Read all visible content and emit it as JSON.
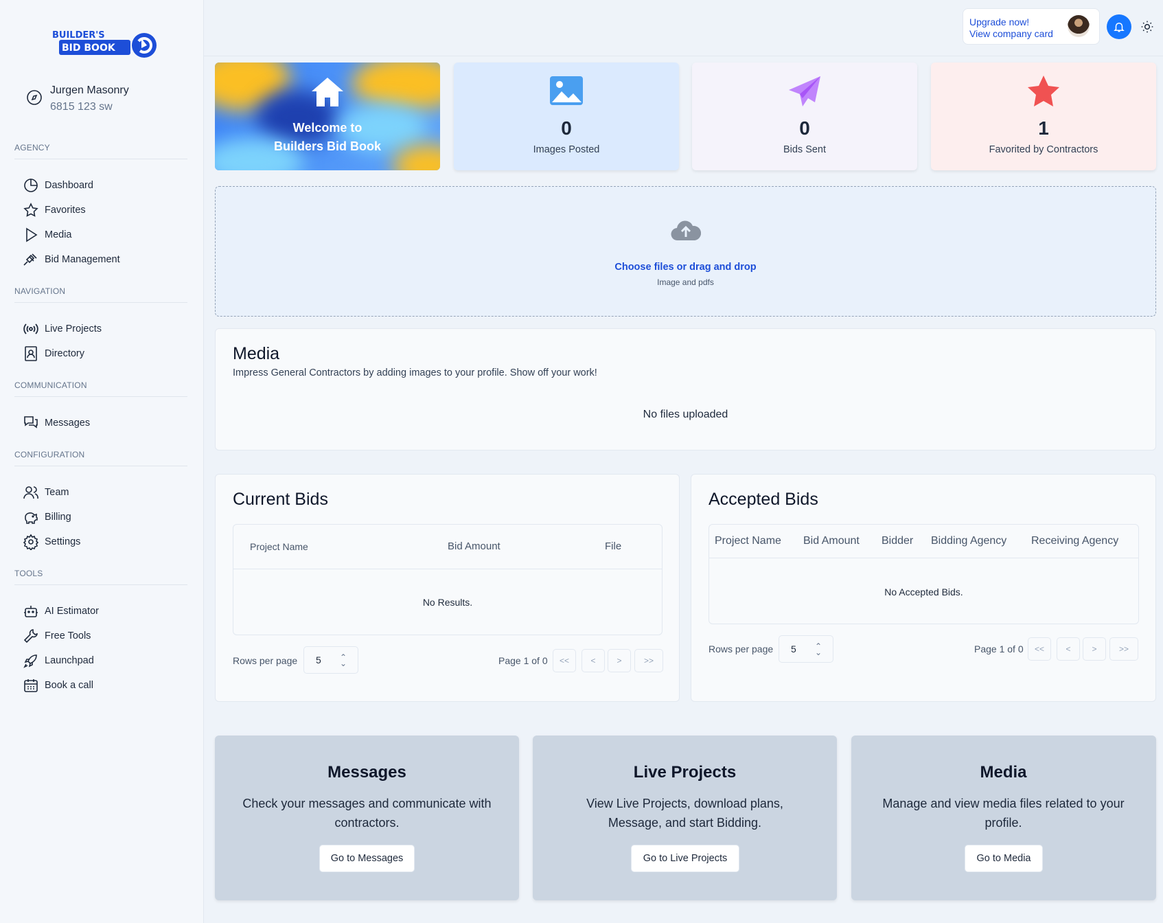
{
  "brand": {
    "line1": "BUILDER'S",
    "line2": "BID BOOK"
  },
  "company": {
    "name": "Jurgen Masonry",
    "address": "6815 123 sw"
  },
  "sidebar": {
    "sections": [
      {
        "title": "AGENCY"
      },
      {
        "title": "NAVIGATION"
      },
      {
        "title": "COMMUNICATION"
      },
      {
        "title": "CONFIGURATION"
      },
      {
        "title": "TOOLS"
      }
    ],
    "items": [
      {
        "label": "Dashboard"
      },
      {
        "label": "Favorites"
      },
      {
        "label": "Media"
      },
      {
        "label": "Bid Management"
      },
      {
        "label": "Live Projects"
      },
      {
        "label": "Directory"
      },
      {
        "label": "Messages"
      },
      {
        "label": "Team"
      },
      {
        "label": "Billing"
      },
      {
        "label": "Settings"
      },
      {
        "label": "AI Estimator"
      },
      {
        "label": "Free Tools"
      },
      {
        "label": "Launchpad"
      },
      {
        "label": "Book a call"
      }
    ]
  },
  "topbar": {
    "upgrade": "Upgrade now!",
    "company_card": "View company card"
  },
  "welcome": {
    "line1": "Welcome to",
    "line2": "Builders Bid Book"
  },
  "stats": [
    {
      "value": "0",
      "label": "Images Posted",
      "icon": "image-icon"
    },
    {
      "value": "0",
      "label": "Bids Sent",
      "icon": "paper-plane-icon"
    },
    {
      "value": "1",
      "label": "Favorited by Contractors",
      "icon": "star-icon"
    }
  ],
  "upload": {
    "choose": "Choose files or drag and drop",
    "hint": "Image and pdfs"
  },
  "media": {
    "title": "Media",
    "description": "Impress General Contractors by adding images to your profile. Show off your work!",
    "empty": "No files uploaded"
  },
  "current_bids": {
    "title": "Current Bids",
    "columns": [
      "Project Name",
      "Bid Amount",
      "File"
    ],
    "empty": "No Results.",
    "rows_per_page_label": "Rows per page",
    "rows_per_page": "5",
    "page_info": "Page 1 of 0"
  },
  "accepted_bids": {
    "title": "Accepted Bids",
    "columns": [
      "Project Name",
      "Bid Amount",
      "Bidder",
      "Bidding Agency",
      "Receiving Agency"
    ],
    "empty": "No Accepted Bids.",
    "rows_per_page_label": "Rows per page",
    "rows_per_page": "5",
    "page_info": "Page 1 of 0"
  },
  "pager": {
    "first": "<<",
    "prev": "<",
    "next": ">",
    "last": ">>"
  },
  "quick_cards": [
    {
      "title": "Messages",
      "description": "Check your messages and communicate with contractors.",
      "button": "Go to Messages"
    },
    {
      "title": "Live Projects",
      "description": "View Live Projects, download plans, Message, and start Bidding.",
      "button": "Go to Live Projects"
    },
    {
      "title": "Media",
      "description": "Manage and view media files related to your profile.",
      "button": "Go to Media"
    }
  ],
  "colors": {
    "accent": "#1677ff",
    "link": "#1d4ed8",
    "images_card": "#dbeafe",
    "bids_card": "#f5f3fb",
    "fav_card": "#fdeeee"
  }
}
